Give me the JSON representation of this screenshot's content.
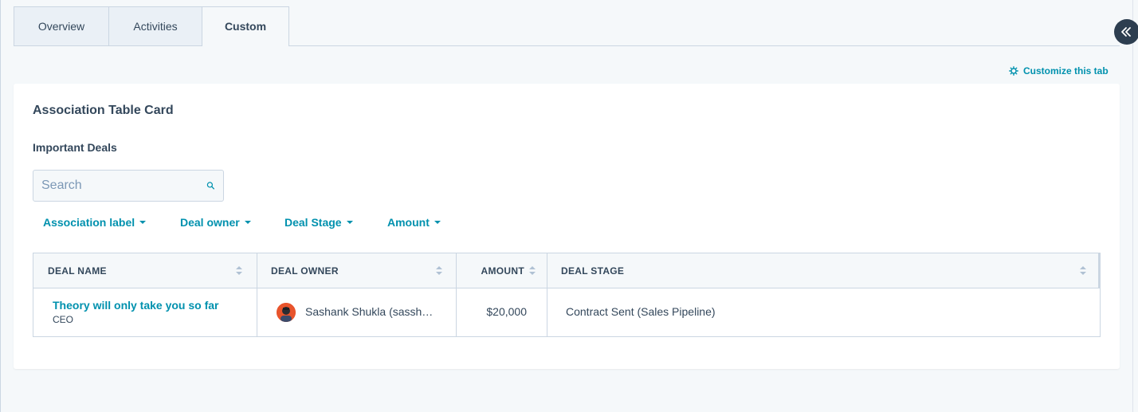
{
  "tabs": [
    {
      "label": "Overview"
    },
    {
      "label": "Activities"
    },
    {
      "label": "Custom"
    }
  ],
  "customize_link": "Customize this tab",
  "card": {
    "title": "Association Table Card",
    "section_title": "Important Deals",
    "search": {
      "placeholder": "Search",
      "value": ""
    },
    "filters": [
      {
        "label": "Association label"
      },
      {
        "label": "Deal owner"
      },
      {
        "label": "Deal Stage"
      },
      {
        "label": "Amount"
      }
    ],
    "table": {
      "columns": [
        "DEAL NAME",
        "DEAL OWNER",
        "AMOUNT",
        "DEAL STAGE"
      ],
      "rows": [
        {
          "deal_name": "Theory will only take you so far",
          "deal_sub": "CEO",
          "owner": "Sashank Shukla (sassh…",
          "amount": "$20,000",
          "stage": "Contract Sent (Sales Pipeline)"
        }
      ]
    }
  },
  "colors": {
    "accent": "#0091ae",
    "text": "#33475b",
    "border": "#cbd6e2",
    "background": "#f5f8fa"
  },
  "icons": {
    "collapse": "double-chevron-left-icon",
    "customize": "gear-icon",
    "search": "search-icon"
  }
}
